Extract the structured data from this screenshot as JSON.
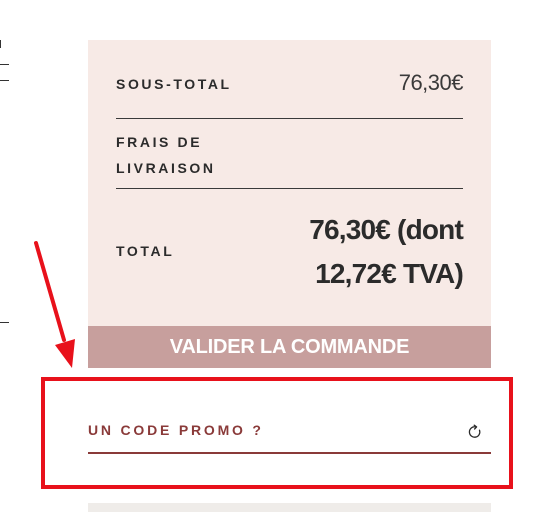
{
  "summary": {
    "subtotal_label": "SOUS-TOTAL",
    "subtotal_value": "76,30€",
    "shipping_label": "FRAIS DE LIVRAISON",
    "total_label": "TOTAL",
    "total_value": "76,30€ (dont 12,72€ TVA)"
  },
  "checkout": {
    "validate_label": "VALIDER LA COMMANDE"
  },
  "promo": {
    "label": "UN CODE PROMO ?",
    "icon": "refresh-icon"
  },
  "colors": {
    "summary_background": "#f7eae6",
    "button_background": "#c79f9d",
    "promo_accent": "#8a3a39",
    "annotation_red": "#e8111b"
  }
}
